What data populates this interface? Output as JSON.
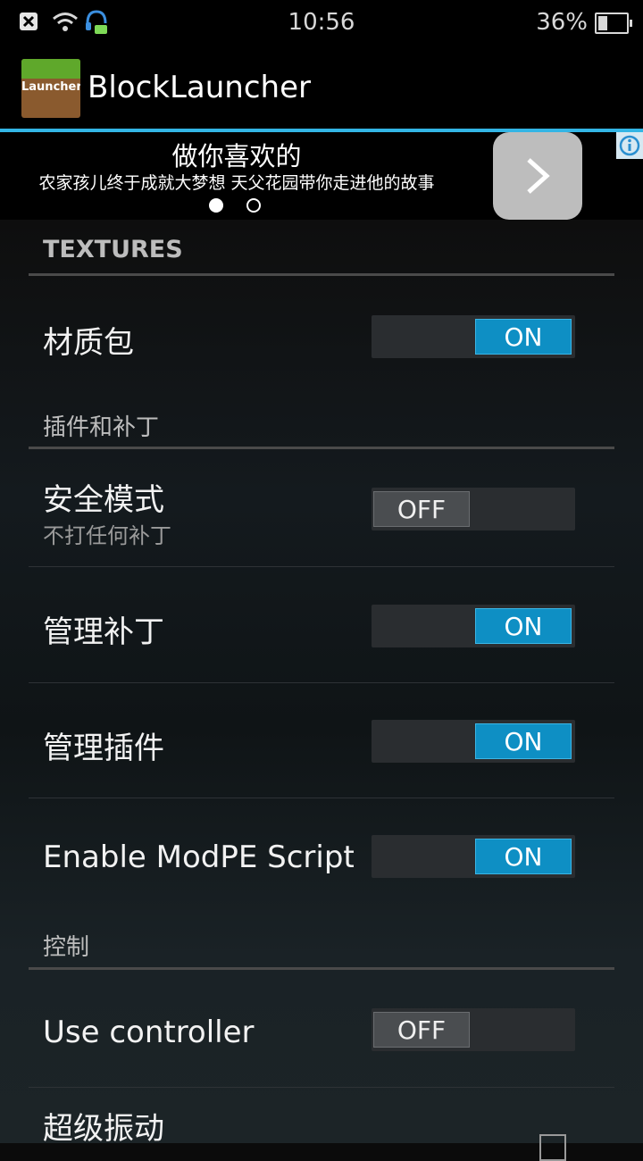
{
  "status_bar": {
    "time": "10:56",
    "battery": "36%"
  },
  "action_bar": {
    "app_icon_label": "Launcher",
    "title": "BlockLauncher"
  },
  "ad": {
    "title": "做你喜欢的",
    "subtitle": "农家孩儿终于成就大梦想 天父花园带你走进他的故事"
  },
  "preferences": {
    "textures_header": "TEXTURES",
    "texture_pack": {
      "title": "材质包",
      "toggle": "ON"
    },
    "plugins_header": "插件和补丁",
    "safe_mode": {
      "title": "安全模式",
      "summary": "不打任何补丁",
      "toggle": "OFF"
    },
    "manage_patches": {
      "title": "管理补丁",
      "toggle": "ON"
    },
    "manage_plugins": {
      "title": "管理插件",
      "toggle": "ON"
    },
    "enable_modpe": {
      "title": "Enable ModPE Script",
      "toggle": "ON"
    },
    "controls_header": "控制",
    "use_controller": {
      "title": "Use controller",
      "toggle": "OFF"
    },
    "super_vibration": {
      "title": "超级振动"
    }
  },
  "colors": {
    "accent": "#33b5e5",
    "toggle_on": "#0e8fc4"
  }
}
